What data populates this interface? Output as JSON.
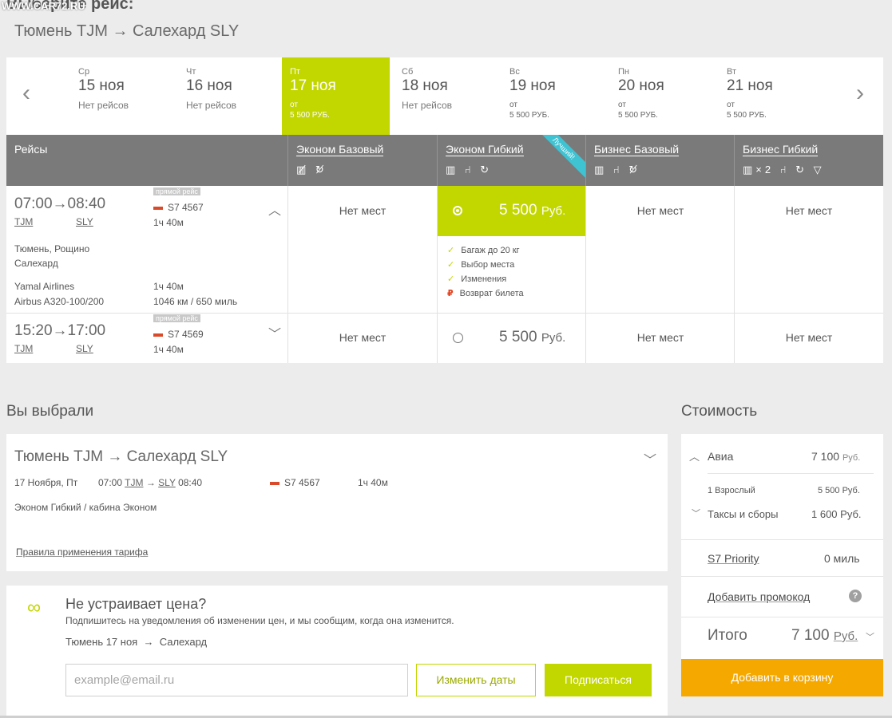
{
  "header": {
    "watermark": "WWW.CAR72.RU",
    "title": "Выберите рейс:",
    "route": "Тюмень TJM → Салехард SLY"
  },
  "dates": [
    {
      "dow": "Ср",
      "day": "15 ноя",
      "status": "Нет рейсов"
    },
    {
      "dow": "Чт",
      "day": "16 ноя",
      "status": "Нет рейсов"
    },
    {
      "dow": "Пт",
      "day": "17 ноя",
      "from": "от",
      "price": "5 500 РУБ."
    },
    {
      "dow": "Сб",
      "day": "18 ноя",
      "status": "Нет рейсов"
    },
    {
      "dow": "Вс",
      "day": "19 ноя",
      "from": "от",
      "price": "5 500 РУБ."
    },
    {
      "dow": "Пн",
      "day": "20 ноя",
      "from": "от",
      "price": "5 500 РУБ."
    },
    {
      "dow": "Вт",
      "day": "21 ноя",
      "from": "от",
      "price": "5 500 РУБ."
    }
  ],
  "nav": {
    "prev": "‹",
    "next": "›"
  },
  "table": {
    "flights_header": "Рейсы",
    "fares": [
      {
        "name": "Эконом Базовый",
        "icons": "▥̸ ↻̸"
      },
      {
        "name": "Эконом Гибкий",
        "icons": "▥ ⑁ ↻",
        "badge": "Лучший!"
      },
      {
        "name": "Бизнес Базовый",
        "icons": "▥ ⑁ ↻̸"
      },
      {
        "name": "Бизнес Гибкий",
        "icons": "▥×2 ⑁ ↻ ▽"
      }
    ],
    "no_seats": "Нет мест",
    "price": "5 500",
    "currency": "Руб.",
    "flights": [
      {
        "dep": "07:00",
        "arr": "08:40",
        "from_code": "TJM",
        "to_code": "SLY",
        "direct": "прямой рейс",
        "number": "S7 4567",
        "duration": "1ч 40м",
        "from_airport": "Тюмень, Рощино",
        "to_airport": "Салехард",
        "airline": "Yamal Airlines",
        "aircraft": "Airbus A320-100/200",
        "duration2": "1ч 40м",
        "distance": "1046 км / 650 миль"
      },
      {
        "dep": "15:20",
        "arr": "17:00",
        "from_code": "TJM",
        "to_code": "SLY",
        "direct": "прямой рейс",
        "number": "S7 4569",
        "duration": "1ч 40м"
      }
    ],
    "features": [
      {
        "mark": "✓",
        "text": "Багаж до 20 кг"
      },
      {
        "mark": "✓",
        "text": "Выбор места"
      },
      {
        "mark": "✓",
        "text": "Изменения"
      },
      {
        "mark": "₽",
        "text": "Возврат билета"
      }
    ]
  },
  "selected": {
    "title": "Вы выбрали",
    "route": "Тюмень TJM → Салехард SLY",
    "date": "17 Ноября, Пт",
    "dep_time": "07:00",
    "dep_code": "TJM",
    "arr_code": "SLY",
    "arr_time": "08:40",
    "number": "S7 4567",
    "duration": "1ч 40м",
    "fare": "Эконом Гибкий / кабина Эконом",
    "rules_link": "Правила применения тарифа"
  },
  "subscribe": {
    "title": "Не устраивает цена?",
    "text": "Подпишитесь на уведомления об изменении цен, и мы сообщим, когда она изменится.",
    "route_from": "Тюмень 17 ноя",
    "route_to": "Салехард",
    "email_placeholder": "example@email.ru",
    "change_dates": "Изменить даты",
    "subscribe_btn": "Подписаться"
  },
  "cost": {
    "title": "Стоимость",
    "avia_label": "Авиа",
    "avia_value": "7 100",
    "adult_label": "1 Взрослый",
    "adult_value": "5 500 Руб.",
    "taxes_label": "Таксы и сборы",
    "taxes_value": "1 600 Руб.",
    "priority_label": "S7 Priority",
    "priority_value": "0 миль",
    "promo_label": "Добавить промокод",
    "total_label": "Итого",
    "total_value": "7 100",
    "currency": "Руб.",
    "cart_btn": "Добавить в корзину"
  },
  "colors": {
    "accent": "#c2d600",
    "orange": "#f5a800",
    "header_gray": "#7a7a7a"
  }
}
